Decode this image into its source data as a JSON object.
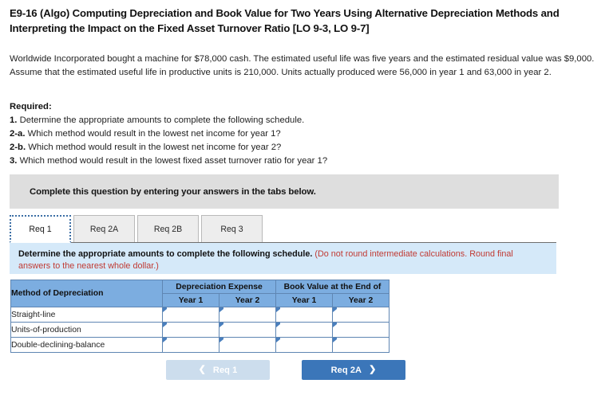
{
  "problem": {
    "title": "E9-16 (Algo) Computing Depreciation and Book Value for Two Years Using Alternative Depreciation Methods and Interpreting the Impact on the Fixed Asset Turnover Ratio [LO 9-3, LO 9-7]",
    "scenario": "Worldwide Incorporated bought a machine for $78,000 cash. The estimated useful life was five years and the estimated residual value was $9,000. Assume that the estimated useful life in productive units is 210,000. Units actually produced were 56,000 in year 1 and 63,000 in year 2."
  },
  "required": {
    "heading": "Required:",
    "items": [
      {
        "num": "1.",
        "text": "Determine the appropriate amounts to complete the following schedule."
      },
      {
        "num": "2-a.",
        "text": "Which method would result in the lowest net income for year 1?"
      },
      {
        "num": "2-b.",
        "text": "Which method would result in the lowest net income for year 2?"
      },
      {
        "num": "3.",
        "text": "Which method would result in the lowest fixed asset turnover ratio for year 1?"
      }
    ]
  },
  "banner": {
    "text": "Complete this question by entering your answers in the tabs below."
  },
  "tabs": [
    {
      "label": "Req 1",
      "active": true
    },
    {
      "label": "Req 2A",
      "active": false
    },
    {
      "label": "Req 2B",
      "active": false
    },
    {
      "label": "Req 3",
      "active": false
    }
  ],
  "instruction": {
    "main": "Determine the appropriate amounts to complete the following schedule.",
    "note": "(Do not round intermediate calculations. Round final answers to the nearest whole dollar.)"
  },
  "schedule": {
    "method_header": "Method of Depreciation",
    "group_headers": [
      "Depreciation Expense",
      "Book Value at the End of"
    ],
    "sub_headers": [
      "Year 1",
      "Year 2",
      "Year 1",
      "Year 2"
    ],
    "rows": [
      {
        "method": "Straight-line",
        "values": [
          "",
          "",
          "",
          ""
        ]
      },
      {
        "method": "Units-of-production",
        "values": [
          "",
          "",
          "",
          ""
        ]
      },
      {
        "method": "Double-declining-balance",
        "values": [
          "",
          "",
          "",
          ""
        ]
      }
    ]
  },
  "nav": {
    "prev_label": "Req 1",
    "prev_icon": "chevron-left-icon",
    "prev_disabled": true,
    "next_label": "Req 2A",
    "next_icon": "chevron-right-icon"
  },
  "colors": {
    "table_header_blue": "#7cade0",
    "panel_blue": "#d5e9f9",
    "banner_gray": "#dedede",
    "button_blue": "#3b76b9",
    "button_disabled": "#ccdded",
    "note_red": "#c03a33"
  }
}
